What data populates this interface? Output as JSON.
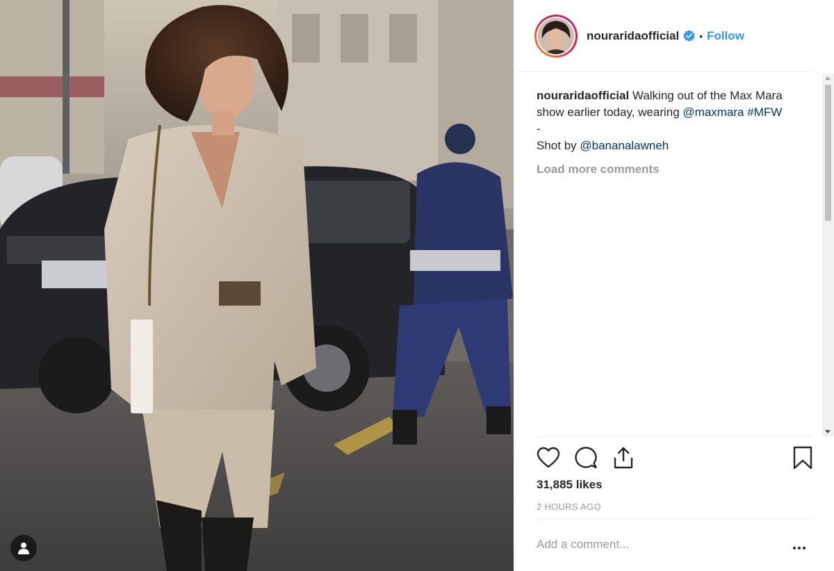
{
  "post": {
    "username": "nouraridaofficial",
    "follow_label": "Follow",
    "separator": "•",
    "caption": {
      "author": "nouraridaofficial",
      "text": " Walking out of the Max Mara show earlier today, wearing ",
      "mention": "@maxmara",
      "hashtag": "#MFW",
      "dash": "-",
      "shot_by_prefix": "Shot by ",
      "shot_by_mention": "@bananalawneh"
    },
    "load_more": "Load more comments",
    "likes": "31,885 likes",
    "time": "2 HOURS AGO",
    "comment_placeholder": "Add a comment..."
  },
  "icons": {
    "like": "heart-icon",
    "comment": "comment-icon",
    "share": "share-icon",
    "save": "bookmark-icon",
    "verified": "verified-badge-icon",
    "user_tag": "user-icon",
    "more": "more-options-icon"
  },
  "colors": {
    "link": "#3897f0",
    "mention": "#003569",
    "muted": "#999999",
    "text": "#262626",
    "verified": "#3897f0"
  }
}
